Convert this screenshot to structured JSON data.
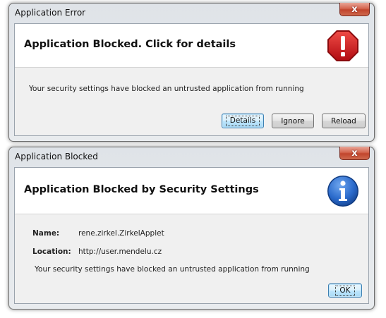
{
  "error_dialog": {
    "title": "Application Error",
    "close_label": "x",
    "heading": "Application Blocked. Click for details",
    "icon": "stop-warning-icon",
    "message": "Your security settings have blocked an untrusted application from running",
    "buttons": {
      "details": "Details",
      "ignore": "Ignore",
      "reload": "Reload"
    }
  },
  "blocked_dialog": {
    "title": "Application Blocked",
    "close_label": "x",
    "heading": "Application Blocked by Security Settings",
    "icon": "info-icon",
    "name_label": "Name:",
    "name_value": "rene.zirkel.ZirkelApplet",
    "location_label": "Location:",
    "location_value": "http://user.mendelu.cz",
    "message": "Your security settings have blocked an untrusted application from running",
    "ok_label": "OK"
  },
  "colors": {
    "stop_red": "#d0191d",
    "info_blue": "#1f5fb8",
    "close_red": "#c9452d"
  }
}
